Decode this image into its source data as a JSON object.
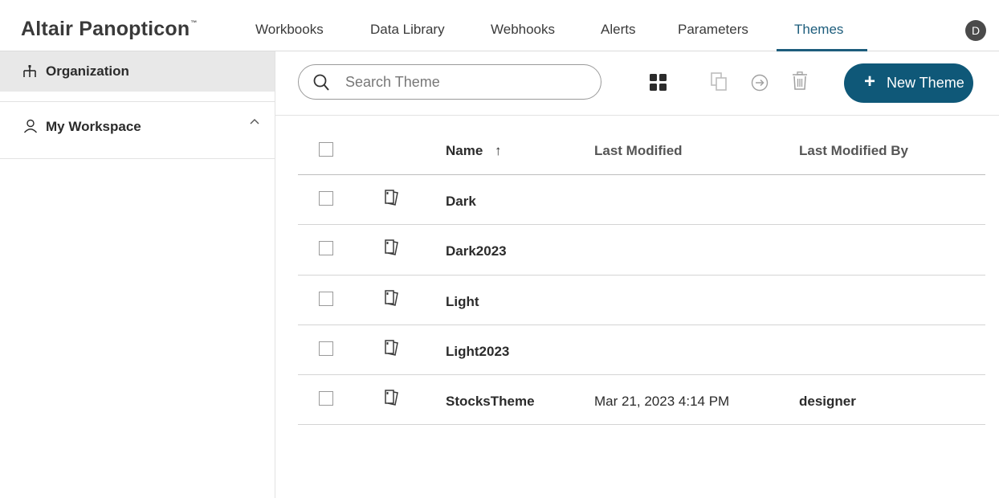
{
  "app": {
    "brand": "Altair Panopticon",
    "brand_tm": "™",
    "user_initial": "D"
  },
  "nav": {
    "items": [
      {
        "label": "Workbooks"
      },
      {
        "label": "Data Library"
      },
      {
        "label": "Webhooks"
      },
      {
        "label": "Alerts"
      },
      {
        "label": "Parameters"
      },
      {
        "label": "Themes",
        "active": true
      }
    ]
  },
  "sidebar": {
    "organization_label": "Organization",
    "workspace_label": "My Workspace"
  },
  "toolbar": {
    "search_placeholder": "Search Theme",
    "new_button_label": "New Theme",
    "new_button_icon": "+",
    "accent_color": "#0f5878"
  },
  "table": {
    "columns": {
      "name": "Name",
      "sort_indicator": "↑",
      "last_modified": "Last Modified",
      "last_modified_by": "Last Modified By"
    },
    "rows": [
      {
        "name": "Dark",
        "last_modified": "",
        "last_modified_by": ""
      },
      {
        "name": "Dark2023",
        "last_modified": "",
        "last_modified_by": ""
      },
      {
        "name": "Light",
        "last_modified": "",
        "last_modified_by": ""
      },
      {
        "name": "Light2023",
        "last_modified": "",
        "last_modified_by": ""
      },
      {
        "name": "StocksTheme",
        "last_modified": "Mar 21, 2023 4:14 PM",
        "last_modified_by": "designer"
      }
    ]
  }
}
